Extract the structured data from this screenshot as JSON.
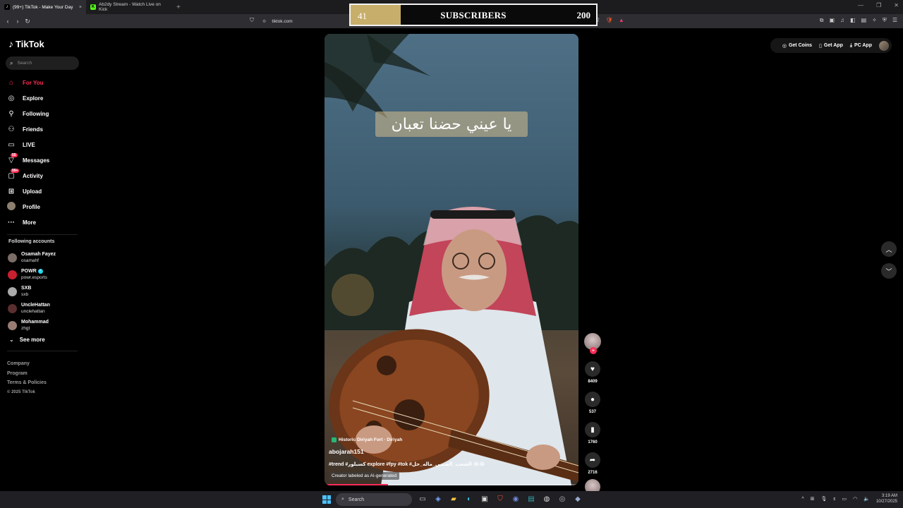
{
  "browser": {
    "tabs": [
      {
        "title": "(99+) TikTok - Make Your Day",
        "icon": "tiktok-icon",
        "active": true
      },
      {
        "title": "Ab2dy Stream - Watch Live on Kick",
        "icon": "kick-icon",
        "active": false
      }
    ],
    "url": "tiktok.com",
    "new_tab": "+",
    "close_tab": "×"
  },
  "overlay": {
    "current": "41",
    "title": "SUBSCRIBERS",
    "goal": "200",
    "progress": 0.205,
    "fill_color": "#c7ae6a"
  },
  "tiktok": {
    "logo_text": "TikTok",
    "search_placeholder": "Search",
    "menu": [
      {
        "label": "For You",
        "icon": "home-icon",
        "active": true
      },
      {
        "label": "Explore",
        "icon": "compass-icon"
      },
      {
        "label": "Following",
        "icon": "user-follow-icon"
      },
      {
        "label": "Friends",
        "icon": "friends-icon"
      },
      {
        "label": "LIVE",
        "icon": "live-icon"
      },
      {
        "label": "Messages",
        "icon": "messages-icon",
        "badge": "55"
      },
      {
        "label": "Activity",
        "icon": "activity-icon",
        "badge": "99+"
      },
      {
        "label": "Upload",
        "icon": "upload-icon"
      },
      {
        "label": "Profile",
        "icon": "avatar"
      },
      {
        "label": "More",
        "icon": "more-icon"
      }
    ],
    "following_title": "Following accounts",
    "accounts": [
      {
        "name": "Osamah Fayez",
        "handle": "osamahf"
      },
      {
        "name": "POWR",
        "handle": "powr.esports",
        "verified": true
      },
      {
        "name": "SXB",
        "handle": "sxb"
      },
      {
        "name": "UncleHattan",
        "handle": "unclehattan"
      },
      {
        "name": "Mohammad",
        "handle": "zhgt"
      }
    ],
    "see_more": "See more",
    "footer": {
      "company": "Company",
      "program": "Program",
      "terms": "Terms & Policies",
      "copyright": "© 2025 TikTok"
    },
    "top_actions": {
      "get_coins": "Get Coins",
      "get_app": "Get App",
      "pc_app": "PC App"
    }
  },
  "video": {
    "caption": "يا عيني حضنا تعبان",
    "location": "Historic Diriyah Fort · Diriyah",
    "author": "abojarah151",
    "tags": "#trend #كسبلور explore #fpy #tok #الشعب_الصيني_ماله_حل 😂😂",
    "ai_label": "Creator labeled as AI-generated",
    "progress": 0.25,
    "likes": "8409",
    "comments": "537",
    "saves": "1760",
    "shares": "2716"
  },
  "taskbar": {
    "search_label": "Search",
    "time": "3:19 AM",
    "date": "10/27/2025"
  }
}
